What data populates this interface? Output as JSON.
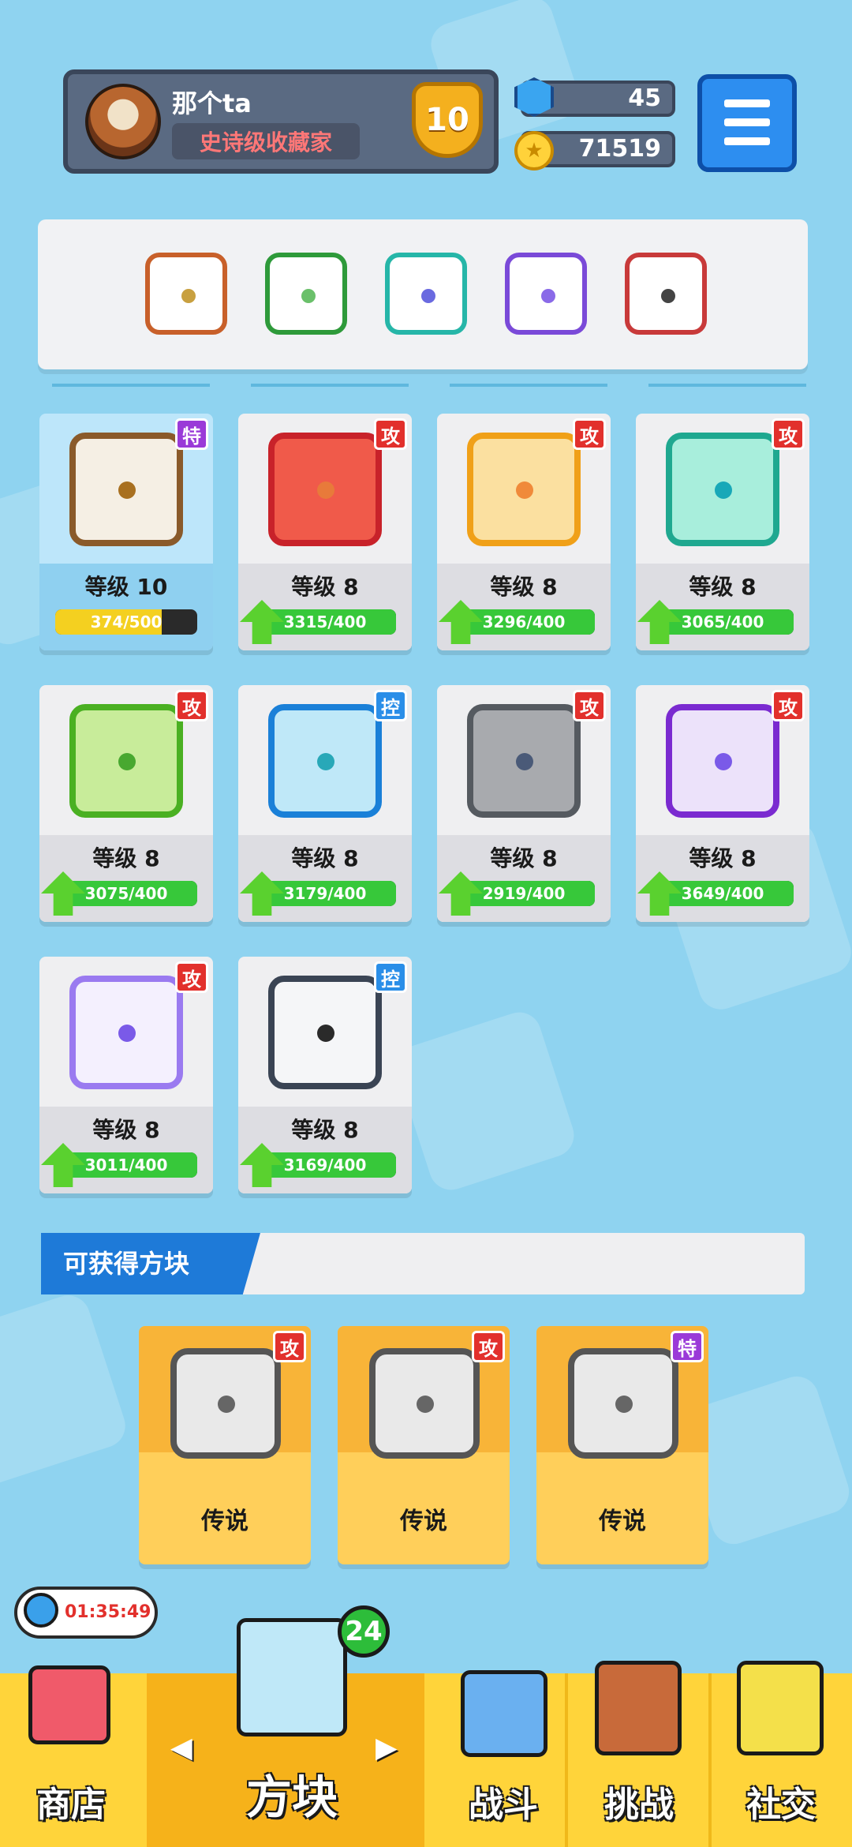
{
  "player": {
    "name": "那个ta",
    "title": "史诗级收藏家",
    "rank": "10"
  },
  "resources": {
    "gems": "45",
    "coins": "71519"
  },
  "deck": {
    "slots": [
      "deck-slot-1",
      "deck-slot-2",
      "deck-slot-3",
      "deck-slot-4",
      "deck-slot-5"
    ]
  },
  "tags": {
    "attack": "攻",
    "control": "控",
    "special": "特"
  },
  "cards": [
    {
      "level": "等级 10",
      "progress": "374/500",
      "tag": "特",
      "fill": 0.75
    },
    {
      "level": "等级 8",
      "progress": "3315/400",
      "tag": "攻",
      "fill": 1
    },
    {
      "level": "等级 8",
      "progress": "3296/400",
      "tag": "攻",
      "fill": 1
    },
    {
      "level": "等级 8",
      "progress": "3065/400",
      "tag": "攻",
      "fill": 1
    },
    {
      "level": "等级 8",
      "progress": "3075/400",
      "tag": "攻",
      "fill": 1
    },
    {
      "level": "等级 8",
      "progress": "3179/400",
      "tag": "控",
      "fill": 1
    },
    {
      "level": "等级 8",
      "progress": "2919/400",
      "tag": "攻",
      "fill": 1
    },
    {
      "level": "等级 8",
      "progress": "3649/400",
      "tag": "攻",
      "fill": 1
    },
    {
      "level": "等级 8",
      "progress": "3011/400",
      "tag": "攻",
      "fill": 1
    },
    {
      "level": "等级 8",
      "progress": "3169/400",
      "tag": "控",
      "fill": 1
    }
  ],
  "obtainable": {
    "title": "可获得方块",
    "items": [
      {
        "label": "传说",
        "tag": "攻"
      },
      {
        "label": "传说",
        "tag": "攻"
      },
      {
        "label": "传说",
        "tag": "特"
      }
    ]
  },
  "timer": "01:35:49",
  "nav": {
    "shop": "商店",
    "blocks": "方块",
    "battle": "战斗",
    "challenge": "挑战",
    "social": "社交",
    "blocks_badge": "24"
  }
}
